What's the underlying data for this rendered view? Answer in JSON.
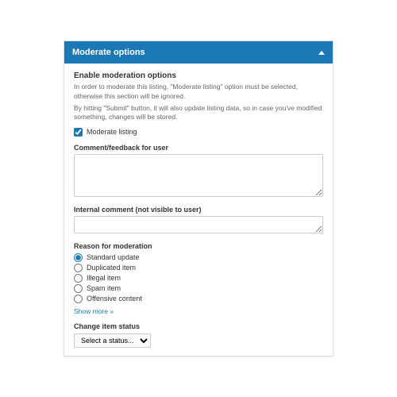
{
  "panel": {
    "header": "Moderate options",
    "section_title": "Enable moderation options",
    "desc1": "In order to moderate this listing, \"Moderate listing\" option must be selected, otherwise this section will be ignored.",
    "desc2": "By hitting \"Submit\" button, it will also update listing data, so in case you've modified something, changes will be stored.",
    "moderate_checkbox": "Moderate listing",
    "comment_label": "Comment/feedback for user",
    "internal_label": "Internal comment (not visible to user)",
    "reason_label": "Reason for moderation",
    "reasons": [
      "Standard update",
      "Duplicated item",
      "Illegal item",
      "Spam item",
      "Offensive content"
    ],
    "show_more": "Show more »",
    "status_label": "Change item status",
    "status_placeholder": "Select a status..."
  }
}
